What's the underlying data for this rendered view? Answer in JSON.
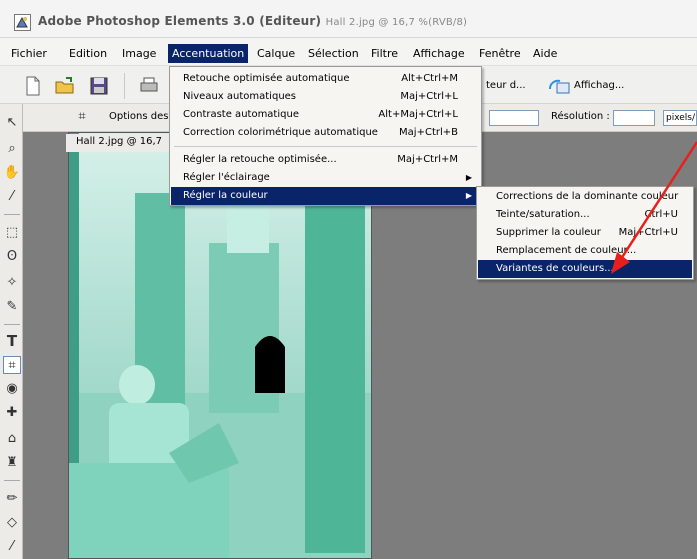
{
  "window": {
    "title": "Adobe Photoshop Elements 3.0 (Editeur)",
    "document_info": "Hall 2.jpg @ 16,7 %(RVB/8)"
  },
  "menubar": {
    "items": [
      "Fichier",
      "Edition",
      "Image",
      "Accentuation",
      "Calque",
      "Sélection",
      "Filtre",
      "Affichage",
      "Fenêtre",
      "Aide"
    ],
    "active": "Accentuation"
  },
  "toolbar": {
    "editor_label": "teur d...",
    "view_label": "Affichag..."
  },
  "options_bar": {
    "options_label": "Options des",
    "resolution_label": "Résolution :",
    "unit_label": "pixels/"
  },
  "document": {
    "tab_label": "Hall 2.jpg @ 16,7"
  },
  "accentuation_menu": {
    "items": [
      {
        "label": "Retouche optimisée automatique",
        "shortcut": "Alt+Ctrl+M"
      },
      {
        "label": "Niveaux automatiques",
        "shortcut": "Maj+Ctrl+L"
      },
      {
        "label": "Contraste automatique",
        "shortcut": "Alt+Maj+Ctrl+L"
      },
      {
        "label": "Correction colorimétrique automatique",
        "shortcut": "Maj+Ctrl+B"
      },
      {
        "label": "Régler la retouche optimisée...",
        "shortcut": "Maj+Ctrl+M"
      },
      {
        "label": "Régler l'éclairage",
        "shortcut": ""
      },
      {
        "label": "Régler la couleur",
        "shortcut": ""
      }
    ]
  },
  "couleur_submenu": {
    "items": [
      {
        "label": "Corrections de la dominante couleur",
        "shortcut": ""
      },
      {
        "label": "Teinte/saturation...",
        "shortcut": "Ctrl+U"
      },
      {
        "label": "Supprimer la couleur",
        "shortcut": "Maj+Ctrl+U"
      },
      {
        "label": "Remplacement de couleur...",
        "shortcut": ""
      },
      {
        "label": "Variantes de couleurs...",
        "shortcut": ""
      }
    ]
  },
  "colors": {
    "highlight": "#0a246a",
    "annotation_arrow": "#e8201c",
    "ice": "#9ed3c5",
    "workspace": "#7d7d7d"
  }
}
